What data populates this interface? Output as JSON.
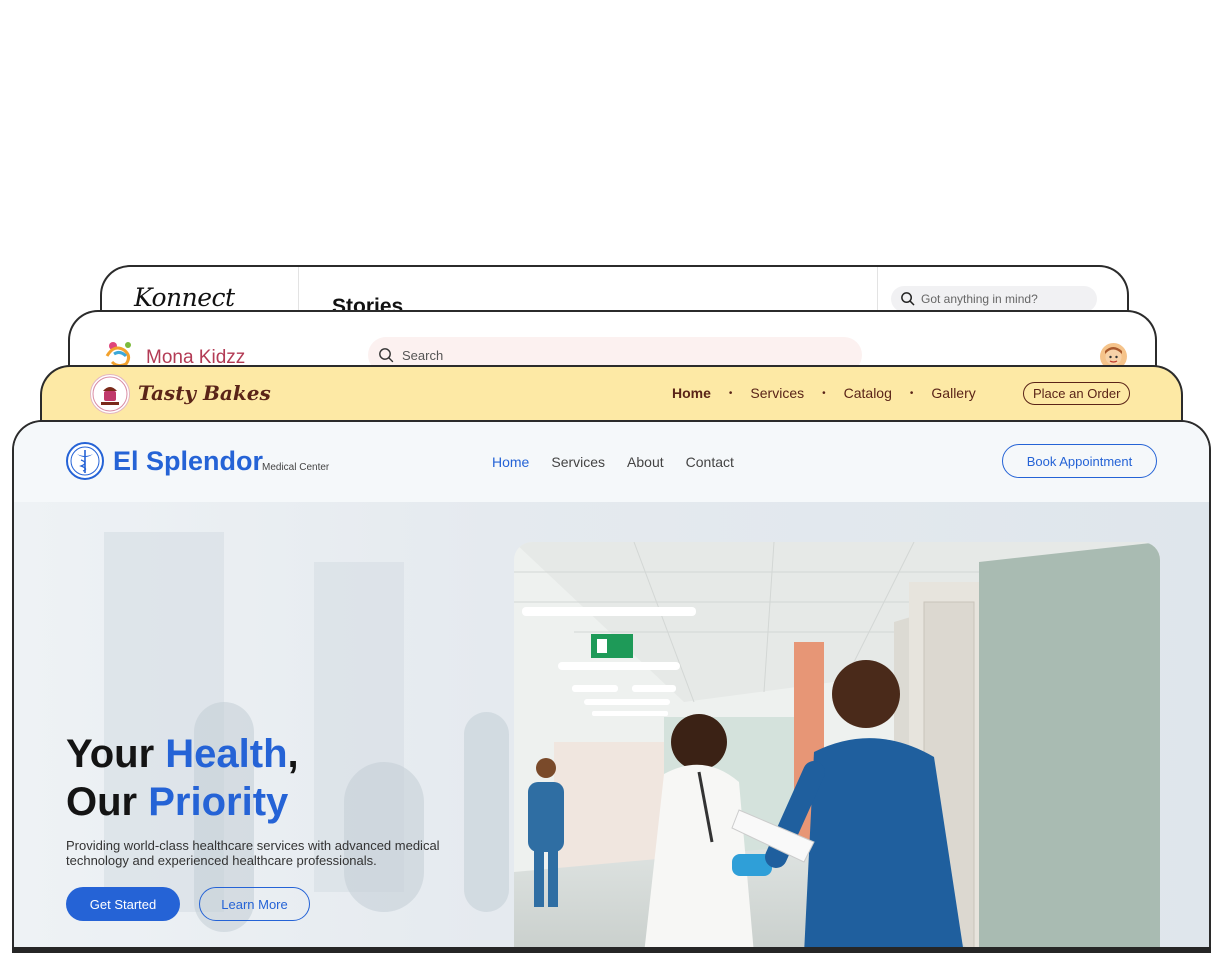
{
  "konnect": {
    "logo": "Konnect",
    "heading": "Stories",
    "search_placeholder": "Got anything in mind?"
  },
  "mona": {
    "brand": "Mona Kidzz",
    "search_placeholder": "Search"
  },
  "tasty": {
    "brand": "Tasty Bakes",
    "nav": [
      "Home",
      "Services",
      "Catalog",
      "Gallery"
    ],
    "order_label": "Place an Order"
  },
  "splendor": {
    "brand": "El Splendor",
    "brand_sub": "Medical Center",
    "nav": [
      "Home",
      "Services",
      "About",
      "Contact"
    ],
    "book_label": "Book Appointment",
    "hero": {
      "line1_a": "Your ",
      "line1_hl": "Health",
      "line1_b": ",",
      "line2_a": "Our ",
      "line2_hl": "Priority",
      "description": "Providing world-class healthcare services with advanced medical technology and experienced healthcare professionals.",
      "primary_cta": "Get Started",
      "secondary_cta": "Learn More"
    },
    "colors": {
      "accent": "#2563d6",
      "tasty_bg": "#fde9a5",
      "mona_brand": "#b33b55"
    }
  }
}
